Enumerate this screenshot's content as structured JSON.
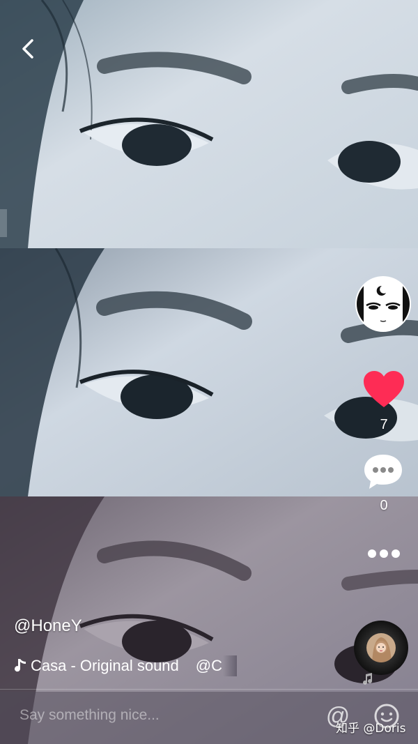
{
  "video": {
    "username": "@HoneY",
    "music_text": "Casa - Original sound",
    "music_tag": "@C",
    "like_count": "7",
    "comment_count": "0"
  },
  "comment_bar": {
    "placeholder": "Say something nice...",
    "at_symbol": "@"
  },
  "watermark": "知乎 @Doris",
  "icons": [
    "back-chevron-icon",
    "heart-icon",
    "comment-bubble-icon",
    "more-dots-icon",
    "music-note-icon",
    "emoji-icon"
  ],
  "colors": {
    "heart": "#fe2c55",
    "panel_top": "#cfd8e0",
    "panel_middle": "#c2ccd8",
    "panel_bottom": "#8a8590"
  }
}
